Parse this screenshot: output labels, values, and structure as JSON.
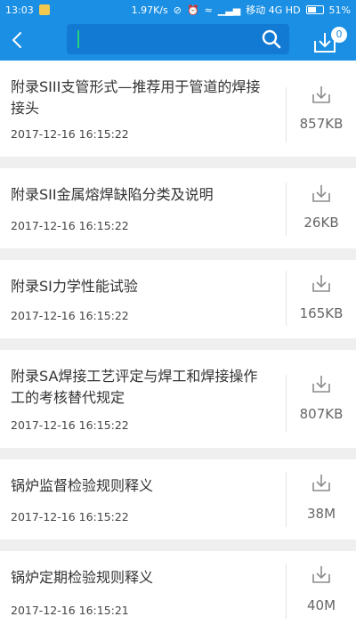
{
  "status_bar": {
    "time": "13:03",
    "speed": "1.97K/s",
    "carrier": "移动 4G HD",
    "battery": "51%"
  },
  "header": {
    "search_placeholder": "",
    "download_badge": "0"
  },
  "files": [
    {
      "title": "附录SIII支管形式—推荐用于管道的焊接接头",
      "time": "2017-12-16 16:15:22",
      "size": "857KB"
    },
    {
      "title": "附录SII金属熔焊缺陷分类及说明",
      "time": "2017-12-16 16:15:22",
      "size": "26KB"
    },
    {
      "title": "附录SI力学性能试验",
      "time": "2017-12-16 16:15:22",
      "size": "165KB"
    },
    {
      "title": "附录SA焊接工艺评定与焊工和焊接操作工的考核替代规定",
      "time": "2017-12-16 16:15:22",
      "size": "807KB"
    },
    {
      "title": "锅炉监督检验规则释义",
      "time": "2017-12-16 16:15:22",
      "size": "38M"
    },
    {
      "title": "锅炉定期检验规则释义",
      "time": "2017-12-16 16:15:21",
      "size": "40M"
    }
  ],
  "colors": {
    "header_bg": "#1a8fe3",
    "search_bg": "#137ad3",
    "page_bg": "#efefef"
  }
}
